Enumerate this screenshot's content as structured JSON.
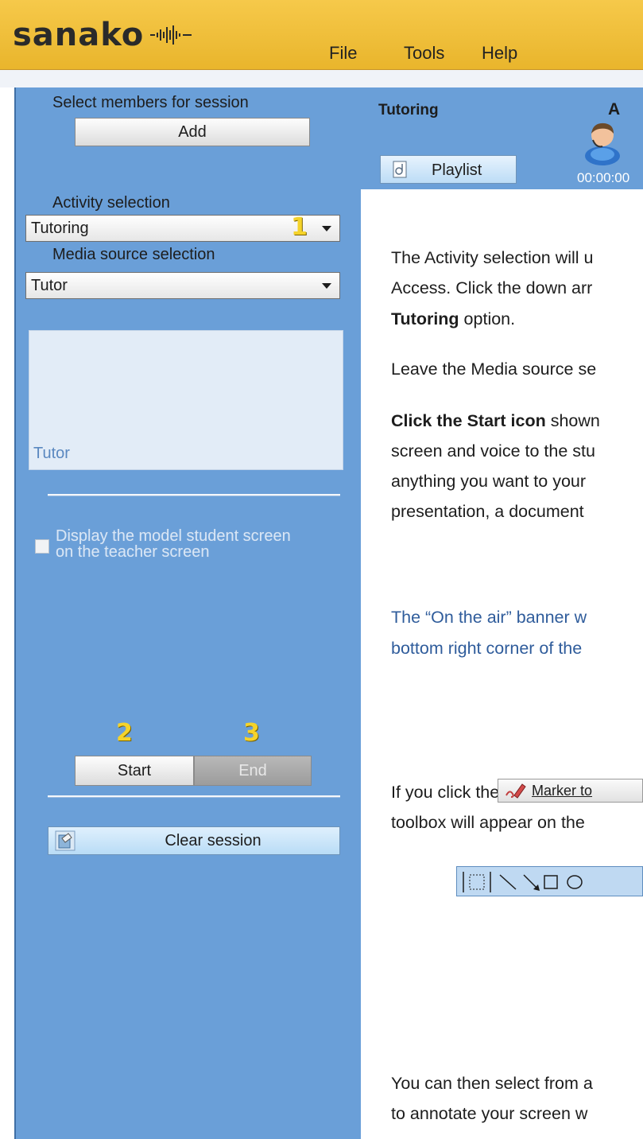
{
  "app": {
    "logo_text": "sanako",
    "menu": [
      "File",
      "Tools",
      "Help"
    ]
  },
  "left_panel": {
    "select_members_label": "Select members for session",
    "add_button": "Add",
    "activity_label": "Activity selection",
    "activity_value": "Tutoring",
    "media_label": "Media source selection",
    "media_value": "Tutor",
    "preview_label": "Tutor",
    "checkbox_label_line1": "Display the model student screen",
    "checkbox_label_line2": "on the teacher screen",
    "start_button": "Start",
    "end_button": "End",
    "clear_button": "Clear session",
    "callouts": [
      "1",
      "2",
      "3"
    ]
  },
  "header": {
    "title": "Tutoring",
    "avatar_letter": "A",
    "timer": "00:00:00",
    "playlist_button": "Playlist"
  },
  "document": {
    "p1_l1": "The Activity selection will u",
    "p1_l2": "Access.  Click the down arr",
    "p1_l3_bold": "Tutoring",
    "p1_l3_rest": " option.",
    "p2": "Leave the Media source se",
    "p3_l1_bold": "Click the Start icon",
    "p3_l1_rest": " shown",
    "p3_l2": "screen and voice to the stu",
    "p3_l3": "anything you want to your",
    "p3_l4": "presentation, a document",
    "p4_l1": "The “On the air” banner w",
    "p4_l2": "bottom right corner of the",
    "p5_l1_before": "If you click the ",
    "marker_tool_label": "Marker to",
    "p5_l2": "toolbox will appear on the",
    "p6_l1": "You can then select from a",
    "p6_l2": "to annotate your screen w"
  },
  "colors": {
    "topbar": "#f0c13e",
    "panel_blue": "#6a9fd8",
    "callout_yellow": "#f5d32a",
    "link_blue": "#2f5c9b"
  },
  "icons": [
    "sound-wave-icon",
    "avatar-icon",
    "playlist-icon",
    "marker-icon",
    "clear-session-icon",
    "dropdown-arrow-icon"
  ]
}
